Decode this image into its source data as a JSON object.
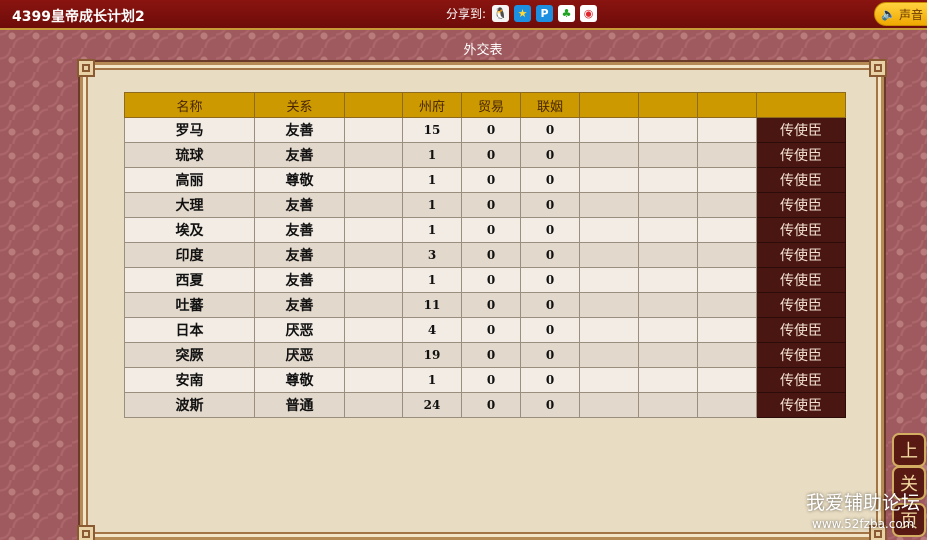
{
  "topbar": {
    "title": "4399皇帝成长计划2",
    "share_label": "分享到:",
    "share_icons": [
      "qq-icon",
      "star-icon",
      "qzone-icon",
      "clover-icon",
      "weibo-icon"
    ],
    "sound_label": "声音"
  },
  "page": {
    "title": "外交表"
  },
  "table": {
    "headers": [
      "名称",
      "关系",
      "",
      "州府",
      "贸易",
      "联姻",
      "",
      "",
      "",
      ""
    ],
    "rows": [
      {
        "name": "罗马",
        "relation": "友善",
        "prefectures": "15",
        "trade": "0",
        "marriage": "0",
        "action": "传使臣"
      },
      {
        "name": "琉球",
        "relation": "友善",
        "prefectures": "1",
        "trade": "0",
        "marriage": "0",
        "action": "传使臣"
      },
      {
        "name": "高丽",
        "relation": "尊敬",
        "prefectures": "1",
        "trade": "0",
        "marriage": "0",
        "action": "传使臣"
      },
      {
        "name": "大理",
        "relation": "友善",
        "prefectures": "1",
        "trade": "0",
        "marriage": "0",
        "action": "传使臣"
      },
      {
        "name": "埃及",
        "relation": "友善",
        "prefectures": "1",
        "trade": "0",
        "marriage": "0",
        "action": "传使臣"
      },
      {
        "name": "印度",
        "relation": "友善",
        "prefectures": "3",
        "trade": "0",
        "marriage": "0",
        "action": "传使臣"
      },
      {
        "name": "西夏",
        "relation": "友善",
        "prefectures": "1",
        "trade": "0",
        "marriage": "0",
        "action": "传使臣"
      },
      {
        "name": "吐蕃",
        "relation": "友善",
        "prefectures": "11",
        "trade": "0",
        "marriage": "0",
        "action": "传使臣"
      },
      {
        "name": "日本",
        "relation": "厌恶",
        "prefectures": "4",
        "trade": "0",
        "marriage": "0",
        "action": "传使臣"
      },
      {
        "name": "突厥",
        "relation": "厌恶",
        "prefectures": "19",
        "trade": "0",
        "marriage": "0",
        "action": "传使臣"
      },
      {
        "name": "安南",
        "relation": "尊敬",
        "prefectures": "1",
        "trade": "0",
        "marriage": "0",
        "action": "传使臣"
      },
      {
        "name": "波斯",
        "relation": "普通",
        "prefectures": "24",
        "trade": "0",
        "marriage": "0",
        "action": "传使臣"
      }
    ]
  },
  "side_buttons": {
    "up": "上",
    "close": "关",
    "third": "页"
  },
  "watermark": {
    "text": "我爱辅助论坛",
    "url": "www.52fzba.com"
  },
  "colors": {
    "header_gold": "#cc9a00",
    "envoy_button": "#4a1611",
    "topbar_red": "#7a0f0b"
  }
}
